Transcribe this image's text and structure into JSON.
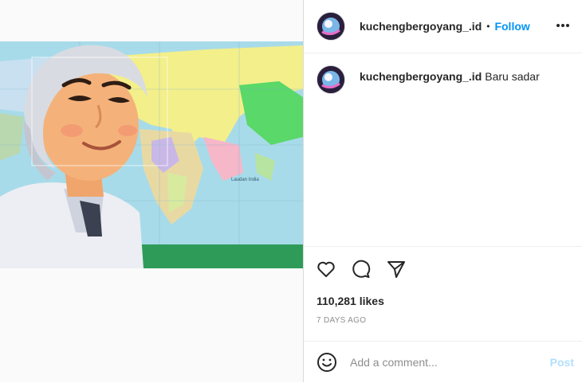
{
  "post": {
    "username": "kuchengbergoyang_.id",
    "follow_label": "Follow",
    "separator": "•",
    "caption_username": "kuchengbergoyang_.id",
    "caption_text": "Baru sadar",
    "likes": "110,281 likes",
    "timestamp": "7 DAYS AGO"
  },
  "comment": {
    "placeholder": "Add a comment...",
    "post_label": "Post"
  },
  "image": {
    "map_labels": [
      "Laudan India"
    ]
  },
  "colors": {
    "accent": "#0095f6",
    "post_disabled": "#b2dffc",
    "muted": "#8e8e8e"
  }
}
